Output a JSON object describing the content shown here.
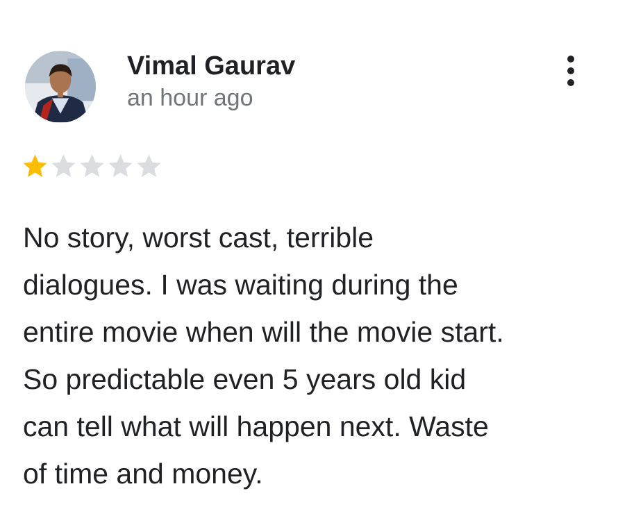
{
  "review": {
    "author": "Vimal Gaurav",
    "time": "an hour ago",
    "rating": 1,
    "rating_max": 5,
    "text": "No story, worst cast, terrible\ndialogues. I was waiting during the\nentire movie when will the movie start.\nSo predictable even 5 years old kid\ncan tell what will happen next. Waste\nof time and money.",
    "more_icon": "more-vertical-icon",
    "star_icon": "star-icon",
    "colors": {
      "star_filled": "#fbbc04",
      "star_empty": "#dadce0",
      "name": "#202124",
      "secondary": "#70757a"
    }
  }
}
